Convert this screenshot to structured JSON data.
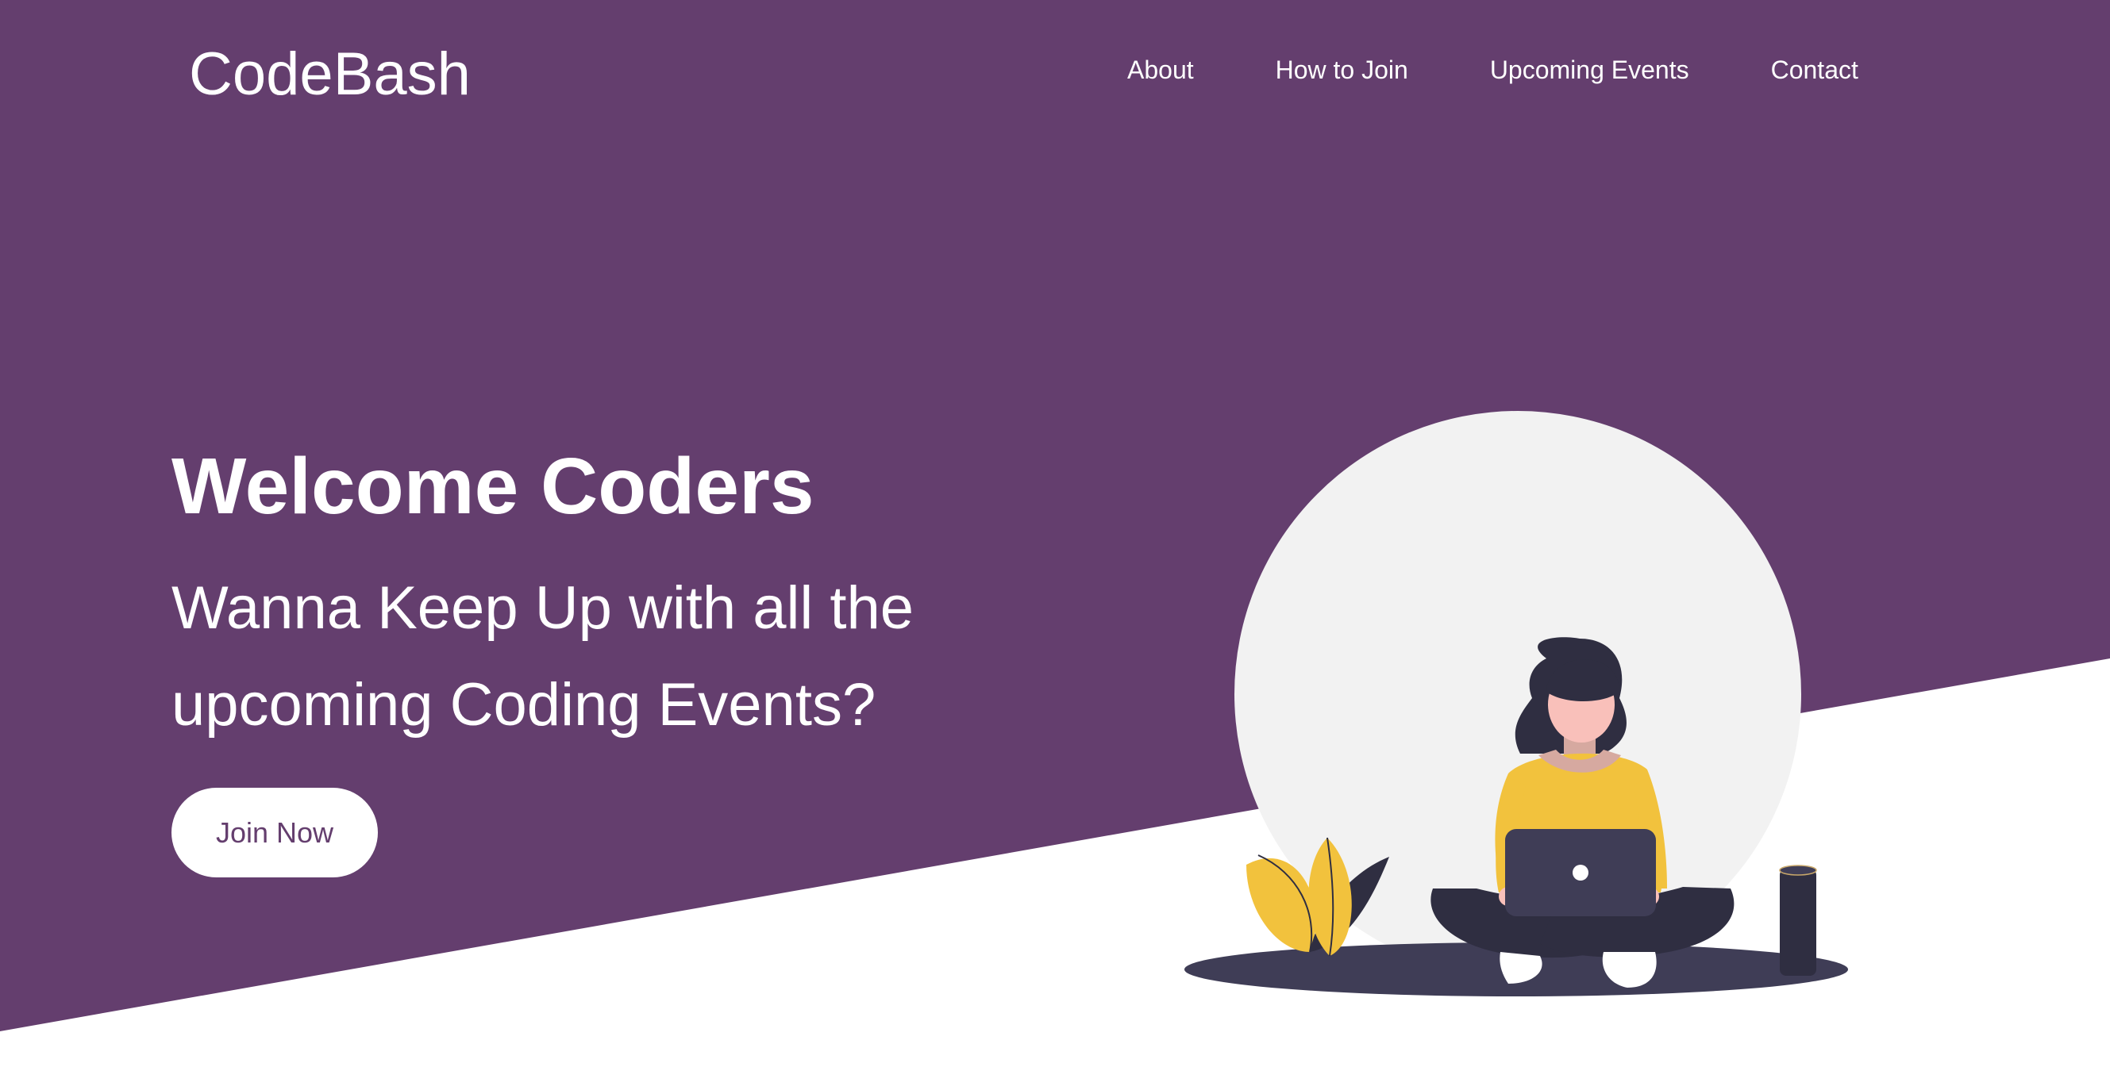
{
  "header": {
    "logo": "CodeBash",
    "nav": [
      {
        "label": "About"
      },
      {
        "label": "How to Join"
      },
      {
        "label": "Upcoming Events"
      },
      {
        "label": "Contact"
      }
    ]
  },
  "hero": {
    "title": "Welcome Coders",
    "subtitle": "Wanna Keep Up with all the upcoming Coding Events?",
    "cta_label": "Join Now"
  },
  "colors": {
    "brand_purple": "#643e6e",
    "background": "#ffffff",
    "accent_yellow": "#f2c23d",
    "dark": "#2f2e41",
    "circle": "#f2f2f2"
  },
  "illustration": {
    "icon": "woman-coding-laptop-illustration"
  }
}
